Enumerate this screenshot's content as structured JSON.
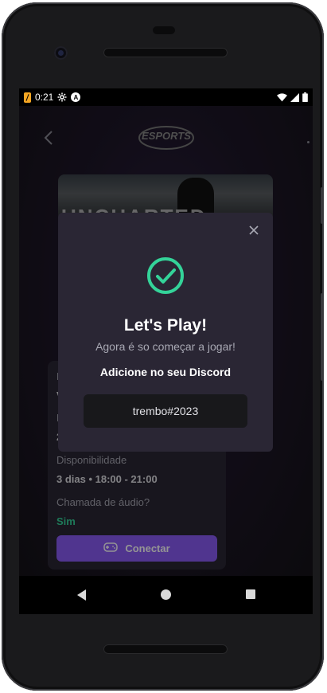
{
  "status_bar": {
    "time": "0:21",
    "icons": [
      "expo-icon",
      "gear-icon",
      "circle-a-icon",
      "wifi-icon",
      "signal-icon",
      "battery-icon"
    ]
  },
  "header": {
    "logo_alt": "ESPORTS"
  },
  "banner": {
    "title": "UNCHARTED"
  },
  "info_card": {
    "name_label": "N",
    "name_value": "V",
    "play_label": "H",
    "play_value": "2",
    "availability_label": "Disponibilidade",
    "availability_value": "3 dias • 18:00 - 21:00",
    "voice_label": "Chamada de áudio?",
    "voice_value": "Sim",
    "connect_label": "Conectar"
  },
  "modal": {
    "title": "Let's Play!",
    "subtitle": "Agora é so começar a jogar!",
    "discord_label": "Adicione no seu Discord",
    "discord_value": "trembo#2023"
  },
  "colors": {
    "accent_green": "#34d399",
    "accent_purple": "#8b5cf6",
    "modal_bg": "#2a2634"
  }
}
